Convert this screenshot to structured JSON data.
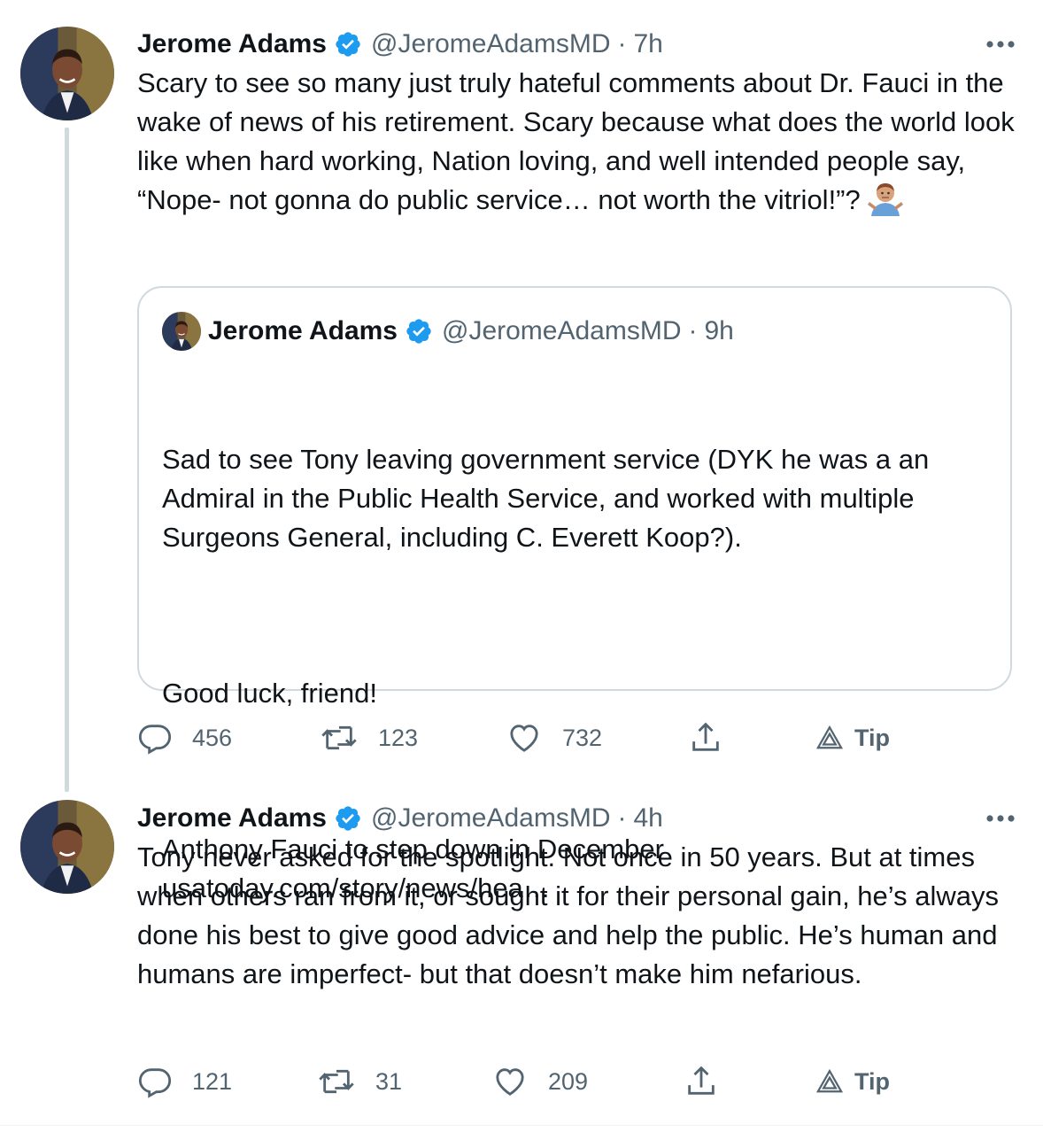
{
  "colors": {
    "verified": "#1d9bf0",
    "text": "#0f1419",
    "secondary": "#536471",
    "border": "#cfd9de"
  },
  "tweet1": {
    "name": "Jerome Adams",
    "handle": "@JeromeAdamsMD",
    "separator": "·",
    "time": "7h",
    "text": "Scary to see so many just truly hateful comments about Dr. Fauci in the wake of news of his retirement. Scary because what does the world look like when hard working, Nation loving, and well intended people say, “Nope- not gonna do public service… not worth the vitriol!”?",
    "emoji_icon": "person-shrugging-emoji",
    "quote": {
      "name": "Jerome Adams",
      "handle": "@JeromeAdamsMD",
      "separator": "·",
      "time": "9h",
      "paragraph1": "Sad to see Tony leaving government service (DYK he was a an Admiral in the Public Health Service, and worked with multiple Surgeons General, including C. Everett Koop?).",
      "paragraph2": "Good luck, friend!",
      "paragraph3": "Anthony Fauci to step down in December\nusatoday.com/story/news/hea…"
    },
    "actions": {
      "replies": "456",
      "retweets": "123",
      "likes": "732",
      "tip": "Tip"
    }
  },
  "tweet2": {
    "name": "Jerome Adams",
    "handle": "@JeromeAdamsMD",
    "separator": "·",
    "time": "4h",
    "text": "Tony never asked for the spotlight. Not once in 50 years. But at times when others ran from it, or sought it for their personal gain, he’s always done his best to give good advice and help the public. He’s human and humans are imperfect- but that doesn’t make him nefarious.",
    "actions": {
      "replies": "121",
      "retweets": "31",
      "likes": "209",
      "tip": "Tip"
    }
  }
}
